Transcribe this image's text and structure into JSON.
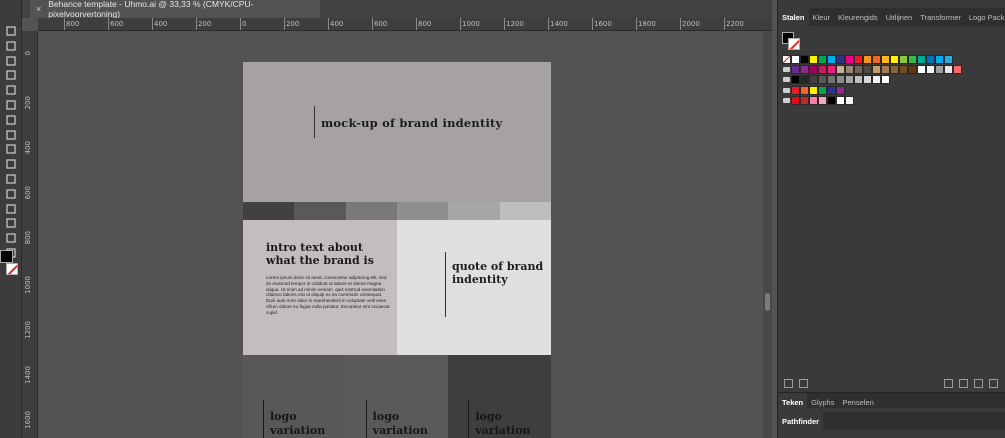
{
  "document_tab": {
    "close_glyph": "×",
    "title": "Behance template - Uhmo.ai @ 33,33 % (CMYK/CPU-pixelvoorvertoning)"
  },
  "toolbar": {
    "tools": [
      "selection-tool-icon",
      "direct-selection-tool-icon",
      "pen-tool-icon",
      "type-tool-icon",
      "line-tool-icon",
      "brush-tool-icon",
      "eraser-tool-icon",
      "rotate-tool-icon",
      "scale-tool-icon",
      "free-transform-tool-icon",
      "shape-builder-tool-icon",
      "gradient-tool-icon",
      "blend-tool-icon",
      "graph-tool-icon",
      "eyedropper-tool-icon",
      "zoom-tool-icon"
    ]
  },
  "ruler_top": {
    "ticks": [
      "800",
      "600",
      "400",
      "200",
      "0",
      "200",
      "400",
      "600",
      "800",
      "1000",
      "1200",
      "1400",
      "1600",
      "1800",
      "2000",
      "2200"
    ]
  },
  "ruler_left": {
    "ticks": [
      "0",
      "200",
      "400",
      "600",
      "800",
      "1000",
      "1200",
      "1400",
      "1600"
    ]
  },
  "artboard": {
    "hero_title": "mock-up of brand indentity",
    "palette_colors": [
      "#424040",
      "#5a5858",
      "#7a7878",
      "#918e8e",
      "#a8a5a5",
      "#c0bdbd"
    ],
    "intro_heading": "intro text about what the brand is",
    "intro_body": "Lorem ipsum dolor sit amet, consectetur adipiscing elit, sed do eiusmod tempor in-cididunt ut labore et dolore magna aliqua. Ut enim ad minim veniam, quis nostrud exercitation ullamco laboris nisi ut aliquip ex ea commodo consequat. Duis aute irure dolor in reprehenderit in voluptate velit esse cillum dolore eu fugiat nulla pariatur. Excepteur sint occaecat cupid",
    "quote": "quote of brand indentity",
    "logos": [
      {
        "label": "logo variation",
        "bg": "#595757"
      },
      {
        "label": "logo variation",
        "bg": "#5b5a5a"
      },
      {
        "label": "logo variation",
        "bg": "#3f3e3e"
      }
    ]
  },
  "panel": {
    "tabs": [
      "Stalen",
      "Kleur",
      "Kleurengids",
      "Uitlijnen",
      "Transformer",
      "Logo Pack"
    ],
    "active_tab": "Stalen",
    "swatch_rows": [
      [
        "none",
        "#ffffff",
        "#000000",
        "#fff200",
        "#00a651",
        "#00aeef",
        "#2e3192",
        "#ec008c",
        "#ed1c24",
        "#f7941d",
        "#f26522",
        "#fdb913",
        "#fff200",
        "#8dc63f",
        "#39b54a",
        "#00a99d",
        "#0072bc",
        "#00aeef",
        "#29abe2"
      ],
      [
        "#662d91",
        "#92278f",
        "#9e005d",
        "#d4145a",
        "#ed1e79",
        "#c7b299",
        "#998675",
        "#736357",
        "#534741",
        "#c69c6d",
        "#a67c52",
        "#8c6239",
        "#754c24",
        "#603813",
        "#ffffff",
        "#f0f0f0",
        "#a0a0a0",
        "#e6e6e6",
        "#ff6666"
      ],
      [
        "#000000",
        "#262626",
        "#404040",
        "#595959",
        "#737373",
        "#8c8c8c",
        "#a6a6a6",
        "#bfbfbf",
        "#d9d9d9",
        "#f2f2f2",
        "#ffffff"
      ],
      [
        "#ed1c24",
        "#f26522",
        "#fff200",
        "#00a651",
        "#2e3192",
        "#92278f"
      ],
      [
        "#e50914",
        "#c1272d",
        "#ff7bac",
        "#f4a6c6",
        "#000000",
        "#ffffff",
        "#f2f2f2"
      ]
    ],
    "lower_tabs": [
      "Teken",
      "Glyphs",
      "Penselen"
    ],
    "lower_active": "Teken",
    "pathfinder_tab": "Pathfinder"
  }
}
